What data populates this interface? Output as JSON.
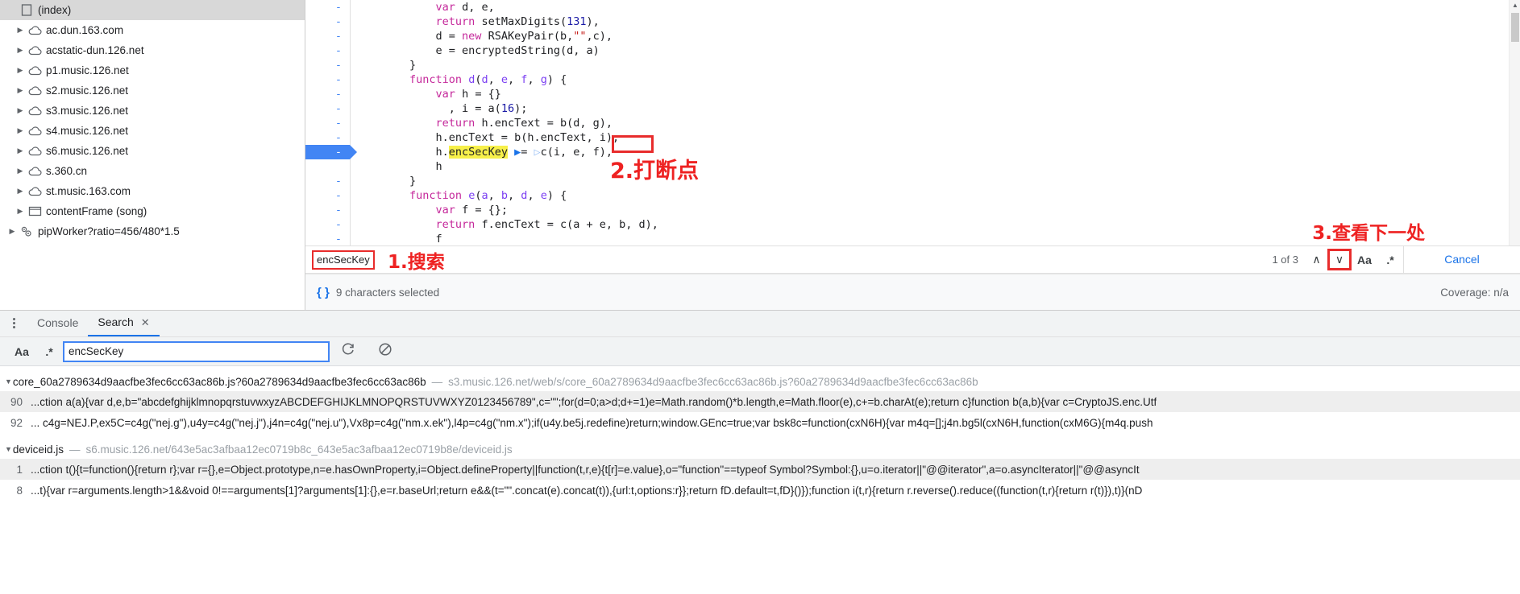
{
  "navigator": {
    "header": {
      "label": "(index)",
      "icon": "page-icon"
    },
    "items": [
      {
        "label": "ac.dun.163.com",
        "icon": "cloud-icon",
        "indent": 1
      },
      {
        "label": "acstatic-dun.126.net",
        "icon": "cloud-icon",
        "indent": 1
      },
      {
        "label": "p1.music.126.net",
        "icon": "cloud-icon",
        "indent": 1
      },
      {
        "label": "s2.music.126.net",
        "icon": "cloud-icon",
        "indent": 1
      },
      {
        "label": "s3.music.126.net",
        "icon": "cloud-icon",
        "indent": 1
      },
      {
        "label": "s4.music.126.net",
        "icon": "cloud-icon",
        "indent": 1
      },
      {
        "label": "s6.music.126.net",
        "icon": "cloud-icon",
        "indent": 1
      },
      {
        "label": "s.360.cn",
        "icon": "cloud-icon",
        "indent": 1
      },
      {
        "label": "st.music.163.com",
        "icon": "cloud-icon",
        "indent": 1
      },
      {
        "label": "contentFrame (song)",
        "icon": "frame-icon",
        "indent": 1
      },
      {
        "label": "pipWorker?ratio=456/480*1.5",
        "icon": "gears-icon",
        "indent": 0
      }
    ]
  },
  "editor": {
    "lines": [
      {
        "gutter": "-",
        "segments": [
          {
            "t": "            ",
            "c": ""
          },
          {
            "t": "var",
            "c": "kw"
          },
          {
            "t": " d, e,",
            "c": ""
          }
        ]
      },
      {
        "gutter": "-",
        "segments": [
          {
            "t": "            ",
            "c": ""
          },
          {
            "t": "return",
            "c": "kw"
          },
          {
            "t": " setMaxDigits(",
            "c": ""
          },
          {
            "t": "131",
            "c": "num"
          },
          {
            "t": "),",
            "c": ""
          }
        ]
      },
      {
        "gutter": "-",
        "segments": [
          {
            "t": "            d = ",
            "c": ""
          },
          {
            "t": "new",
            "c": "kw"
          },
          {
            "t": " RSAKeyPair(b,",
            "c": ""
          },
          {
            "t": "\"\"",
            "c": "str"
          },
          {
            "t": ",c),",
            "c": ""
          }
        ]
      },
      {
        "gutter": "-",
        "segments": [
          {
            "t": "            e = encryptedString(d, a)",
            "c": ""
          }
        ]
      },
      {
        "gutter": "-",
        "segments": [
          {
            "t": "        }",
            "c": ""
          }
        ]
      },
      {
        "gutter": "-",
        "segments": [
          {
            "t": "        ",
            "c": ""
          },
          {
            "t": "function",
            "c": "kw"
          },
          {
            "t": " ",
            "c": ""
          },
          {
            "t": "d",
            "c": "kw2"
          },
          {
            "t": "(",
            "c": ""
          },
          {
            "t": "d",
            "c": "kw2"
          },
          {
            "t": ", ",
            "c": ""
          },
          {
            "t": "e",
            "c": "kw2"
          },
          {
            "t": ", ",
            "c": ""
          },
          {
            "t": "f",
            "c": "kw2"
          },
          {
            "t": ", ",
            "c": ""
          },
          {
            "t": "g",
            "c": "kw2"
          },
          {
            "t": ") {",
            "c": ""
          }
        ]
      },
      {
        "gutter": "-",
        "segments": [
          {
            "t": "            ",
            "c": ""
          },
          {
            "t": "var",
            "c": "kw"
          },
          {
            "t": " h = {}",
            "c": ""
          }
        ]
      },
      {
        "gutter": "-",
        "segments": [
          {
            "t": "              , i = a(",
            "c": ""
          },
          {
            "t": "16",
            "c": "num"
          },
          {
            "t": ");",
            "c": ""
          }
        ]
      },
      {
        "gutter": "-",
        "segments": [
          {
            "t": "            ",
            "c": ""
          },
          {
            "t": "return",
            "c": "kw"
          },
          {
            "t": " h.encText = b(d, g),",
            "c": ""
          }
        ]
      },
      {
        "gutter": "-",
        "segments": [
          {
            "t": "            h.encText = b(h.encText, i),",
            "c": ""
          }
        ]
      },
      {
        "gutter": "-",
        "breakpoint": true,
        "segments": [
          {
            "t": "            h.",
            "c": ""
          },
          {
            "t": "encSecKey",
            "c": "hl-token"
          },
          {
            "t": " ",
            "c": ""
          },
          {
            "t": "▶",
            "c": "arr-filled"
          },
          {
            "t": "= ",
            "c": ""
          },
          {
            "t": "▷",
            "c": "arr-hollow"
          },
          {
            "t": "c(i, e, f),",
            "c": ""
          }
        ]
      },
      {
        "gutter": "",
        "segments": [
          {
            "t": "            h",
            "c": ""
          }
        ]
      },
      {
        "gutter": "-",
        "segments": [
          {
            "t": "        }",
            "c": ""
          }
        ]
      },
      {
        "gutter": "-",
        "segments": [
          {
            "t": "        ",
            "c": ""
          },
          {
            "t": "function",
            "c": "kw"
          },
          {
            "t": " ",
            "c": ""
          },
          {
            "t": "e",
            "c": "kw2"
          },
          {
            "t": "(",
            "c": ""
          },
          {
            "t": "a",
            "c": "kw2"
          },
          {
            "t": ", ",
            "c": ""
          },
          {
            "t": "b",
            "c": "kw2"
          },
          {
            "t": ", ",
            "c": ""
          },
          {
            "t": "d",
            "c": "kw2"
          },
          {
            "t": ", ",
            "c": ""
          },
          {
            "t": "e",
            "c": "kw2"
          },
          {
            "t": ") {",
            "c": ""
          }
        ]
      },
      {
        "gutter": "-",
        "segments": [
          {
            "t": "            ",
            "c": ""
          },
          {
            "t": "var",
            "c": "kw"
          },
          {
            "t": " f = {};",
            "c": ""
          }
        ]
      },
      {
        "gutter": "-",
        "segments": [
          {
            "t": "            ",
            "c": ""
          },
          {
            "t": "return",
            "c": "kw"
          },
          {
            "t": " f.encText = c(a + e, b, d),",
            "c": ""
          }
        ]
      },
      {
        "gutter": "-",
        "segments": [
          {
            "t": "            f",
            "c": ""
          }
        ]
      }
    ],
    "annotations": {
      "breakpoint": "2.打断点",
      "search": "1.搜索",
      "next_match": "3.查看下一处"
    }
  },
  "find_bar": {
    "query": "encSecKey",
    "count": "1 of 3",
    "prev_icon": "chevron-up-icon",
    "next_icon": "chevron-down-icon",
    "match_case_label": "Aa",
    "regex_label": ".*",
    "cancel_label": "Cancel"
  },
  "editor_status": {
    "pretty_print_icon": "{ }",
    "selection": "9 characters selected",
    "coverage": "Coverage: n/a"
  },
  "drawer": {
    "tabs": [
      {
        "label": "Console",
        "active": false,
        "closable": false
      },
      {
        "label": "Search",
        "active": true,
        "closable": true
      }
    ],
    "toolbar": {
      "match_case_label": "Aa",
      "regex_label": ".*",
      "query": "encSecKey",
      "refresh_icon": "refresh-icon",
      "clear_icon": "clear-icon"
    },
    "results": [
      {
        "file": "core_60a2789634d9aacfbe3fec6cc63ac86b.js?60a2789634d9aacfbe3fec6cc63ac86b",
        "url": "s3.music.126.net/web/s/core_60a2789634d9aacfbe3fec6cc63ac86b.js?60a2789634d9aacfbe3fec6cc63ac86b",
        "matches": [
          {
            "line": "90",
            "text": "...ction a(a){var d,e,b=\"abcdefghijklmnopqrstuvwxyzABCDEFGHIJKLMNOPQRSTUVWXYZ0123456789\",c=\"\";for(d=0;a>d;d+=1)e=Math.random()*b.length,e=Math.floor(e),c+=b.charAt(e);return c}function b(a,b){var c=CryptoJS.enc.Utf"
          },
          {
            "line": "92",
            "text": "... c4g=NEJ.P,ex5C=c4g(\"nej.g\"),u4y=c4g(\"nej.j\"),j4n=c4g(\"nej.u\"),Vx8p=c4g(\"nm.x.ek\"),l4p=c4g(\"nm.x\");if(u4y.be5j.redefine)return;window.GEnc=true;var bsk8c=function(cxN6H){var m4q=[];j4n.bg5l(cxN6H,function(cxM6G){m4q.push"
          }
        ]
      },
      {
        "file": "deviceid.js",
        "url": "s6.music.126.net/643e5ac3afbaa12ec0719b8c_643e5ac3afbaa12ec0719b8e/deviceid.js",
        "matches": [
          {
            "line": "1",
            "text": "...ction t(){t=function(){return r};var r={},e=Object.prototype,n=e.hasOwnProperty,i=Object.defineProperty||function(t,r,e){t[r]=e.value},o=\"function\"==typeof Symbol?Symbol:{},u=o.iterator||\"@@iterator\",a=o.asyncIterator||\"@@asyncIt"
          },
          {
            "line": "8",
            "text": "...t){var r=arguments.length>1&&void 0!==arguments[1]?arguments[1]:{},e=r.baseUrl;return e&&(t=\"\".concat(e).concat(t)),{url:t,options:r}};return fD.default=t,fD}()});function i(t,r){return r.reverse().reduce((function(t,r){return r(t)}),t)}(nD"
          }
        ]
      }
    ]
  }
}
